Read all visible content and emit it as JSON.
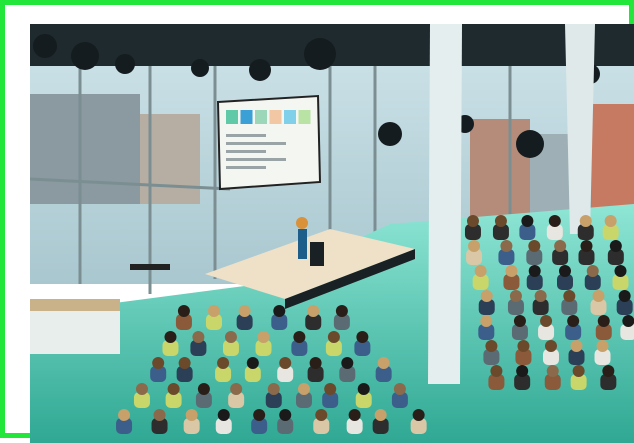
{
  "frame": {
    "border_color": "#22e63a"
  },
  "palette": {
    "floor": "#3fbfa8",
    "floor_light": "#7fe0cf",
    "stage": "#efe0c8",
    "screen": "#f4f6f2",
    "accent": "#4cc3c0"
  },
  "scene": {
    "subject": "conference-hall-event",
    "slide_tiles": [
      "#5fc9a8",
      "#3aa0d6",
      "#9bd7b8",
      "#f1c7a4",
      "#7fd0e8",
      "#b8e3a4"
    ],
    "audience_rows": [
      6,
      7,
      8,
      9,
      10
    ]
  }
}
